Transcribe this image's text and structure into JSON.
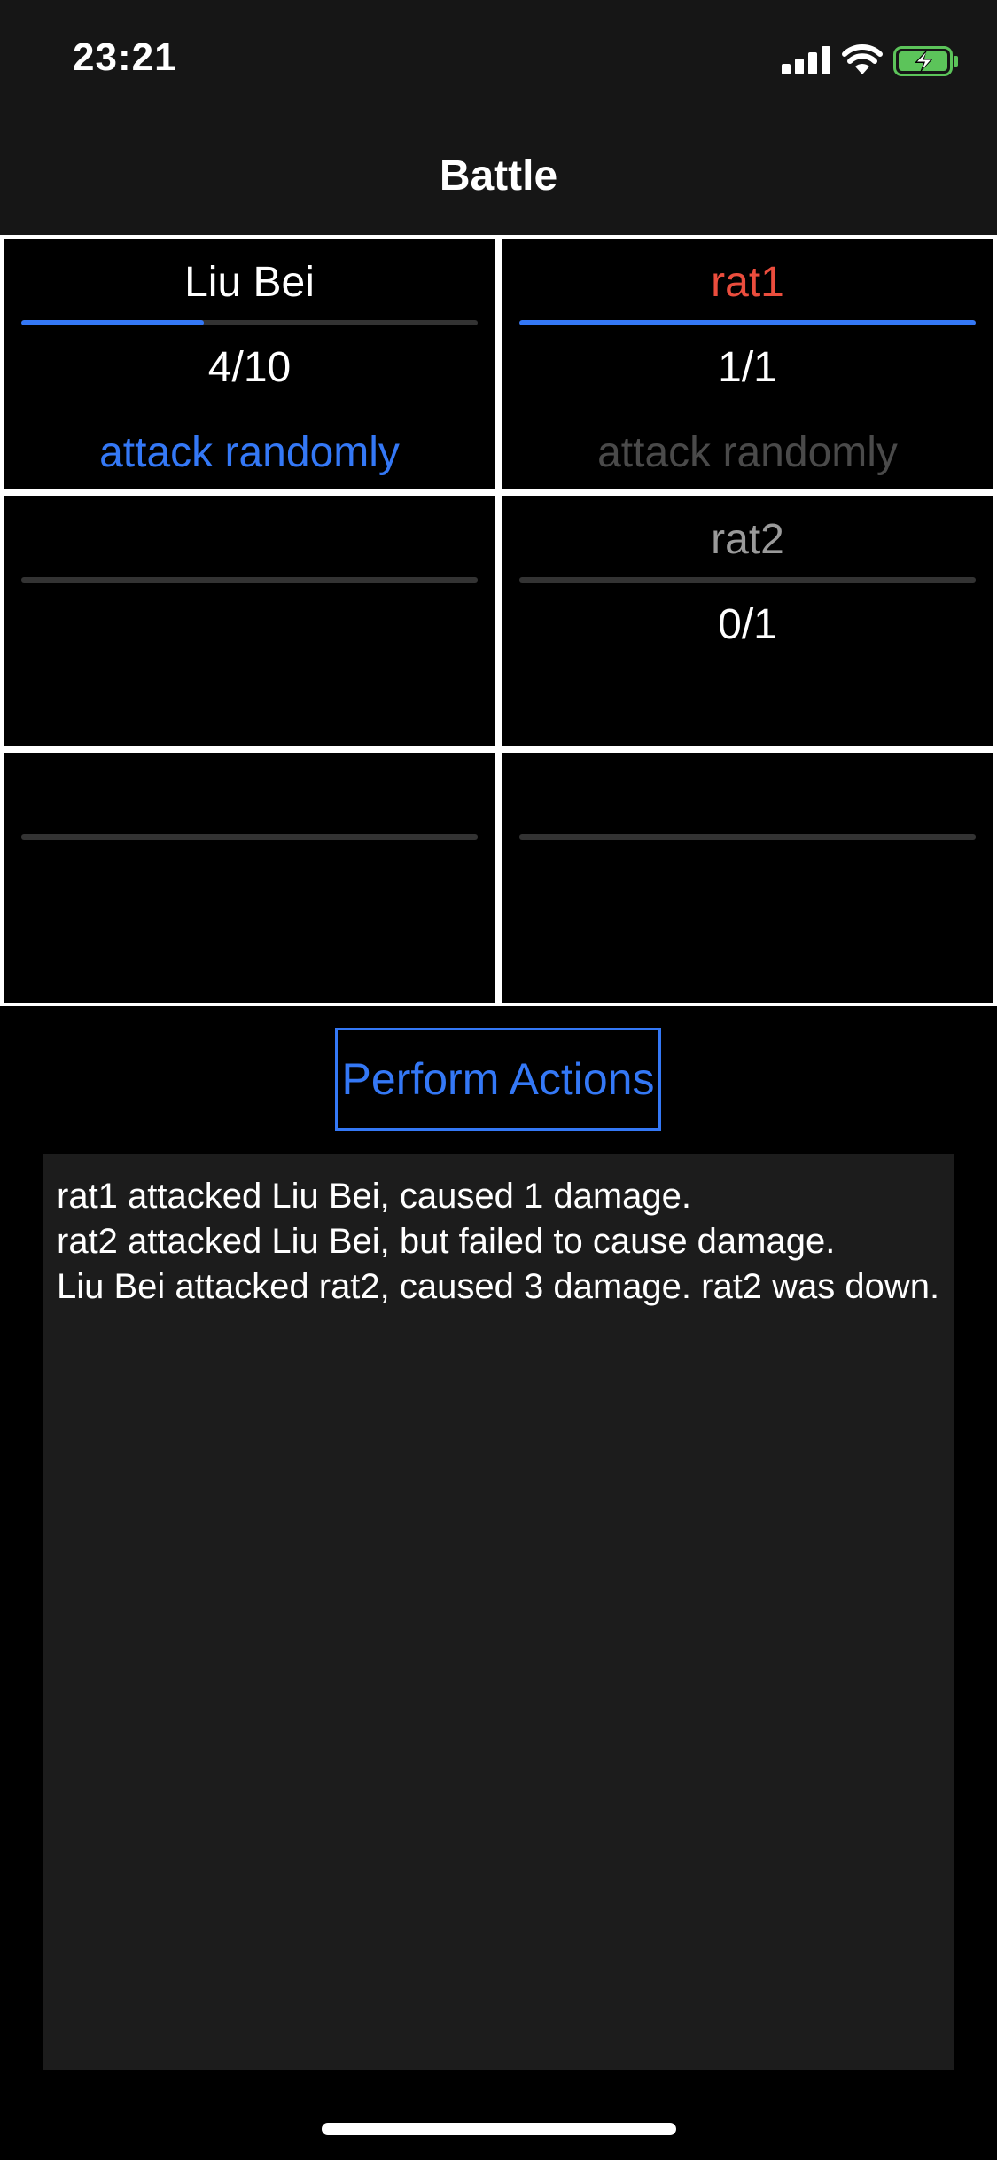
{
  "status_bar": {
    "time": "23:21",
    "icons": [
      "cellular-signal-icon",
      "wifi-icon",
      "battery-charging-icon"
    ]
  },
  "nav": {
    "title": "Battle"
  },
  "colors": {
    "accent": "#3478f6",
    "target_red": "#eb4d3d",
    "dim_gray": "#4a4a4a",
    "name_gray": "#9a9a9a",
    "log_bg": "#1c1c1c"
  },
  "party": [
    {
      "name": "Liu Bei",
      "hp": "4/10",
      "hp_fraction": 0.4,
      "action": "attack randomly"
    },
    {
      "name": "",
      "hp": "",
      "hp_fraction": 0,
      "action": ""
    },
    {
      "name": "",
      "hp": "",
      "hp_fraction": 0,
      "action": ""
    }
  ],
  "enemies": [
    {
      "name": "rat1",
      "hp": "1/1",
      "hp_fraction": 1.0,
      "action": "attack randomly",
      "targeted": true
    },
    {
      "name": "rat2",
      "hp": "0/1",
      "hp_fraction": 0,
      "action": "",
      "targeted": false
    },
    {
      "name": "",
      "hp": "",
      "hp_fraction": 0,
      "action": ""
    }
  ],
  "perform_button": {
    "label": "Perform Actions"
  },
  "log": [
    "rat1 attacked Liu Bei, caused 1 damage.",
    "rat2 attacked Liu Bei, but failed to cause damage.",
    "Liu Bei attacked rat2, caused 3 damage. rat2 was down."
  ]
}
